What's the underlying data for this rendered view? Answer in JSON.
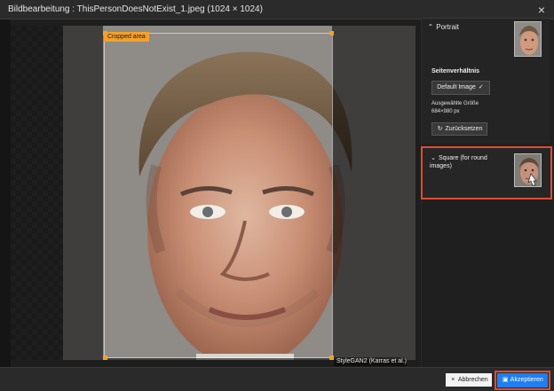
{
  "window": {
    "title": "Bildbearbeitung : ThisPersonDoesNotExist_1.jpeg (1024 × 1024)",
    "close_icon": "close-icon"
  },
  "canvas": {
    "crop_label": "Cropped area",
    "credit": "StyleGAN2 (Karras et al.)"
  },
  "sidebar": {
    "portrait": {
      "toggle_icon": "chevron-up-icon",
      "label": "Portrait"
    },
    "aspect_ratio_title": "Seitenverhältnis",
    "default_button": "Default Image",
    "default_check_icon": "check-icon",
    "selected_size_label": "Ausgewählte Größe",
    "selected_size_value": "684×980 px",
    "reset_icon": "refresh-icon",
    "reset_button": "Zurücksetzen",
    "square": {
      "toggle_icon": "chevron-down-icon",
      "label": "Square (for round images)"
    }
  },
  "footer": {
    "cancel_icon": "close-icon",
    "cancel_label": "Abbrechen",
    "accept_icon": "save-icon",
    "accept_label": "Akzeptieren"
  },
  "colors": {
    "accent_orange": "#f4a02c",
    "highlight_red": "#e34b32",
    "primary_blue": "#1f7ff0"
  }
}
